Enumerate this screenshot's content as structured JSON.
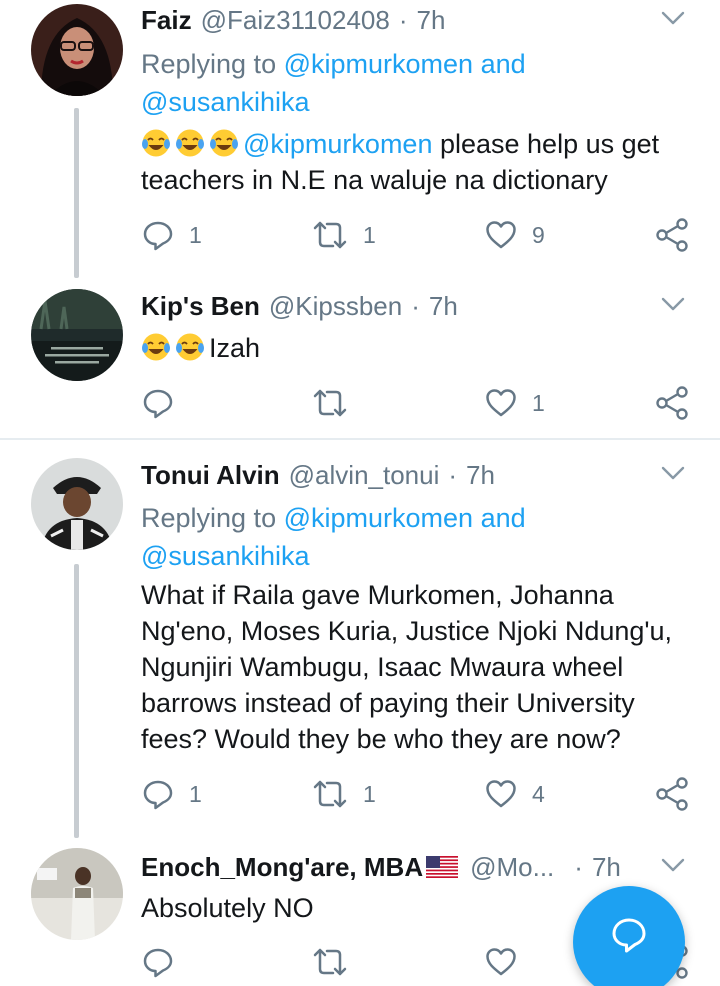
{
  "tweets": [
    {
      "display_name": "Faiz",
      "handle": "@Faiz31102408",
      "separator": "·",
      "time": "7h",
      "replying_prefix": "Replying to",
      "replying_users": [
        "@kipmurkomen",
        "and",
        "@susankihika"
      ],
      "body_mention": "@kipmurkomen",
      "body_text": " please help us get teachers in N.E na waluje na dictionary",
      "emoji_count": 3,
      "reply_count": "1",
      "retweet_count": "1",
      "like_count": "9"
    },
    {
      "display_name": "Kip's Ben",
      "handle": "@Kipssben",
      "separator": "·",
      "time": "7h",
      "body_text": "Izah",
      "emoji_count": 2,
      "reply_count": "",
      "retweet_count": "",
      "like_count": "1"
    },
    {
      "display_name": "Tonui Alvin",
      "handle": "@alvin_tonui",
      "separator": "·",
      "time": "7h",
      "replying_prefix": "Replying to",
      "replying_users": [
        "@kipmurkomen",
        "and",
        "@susankihika"
      ],
      "body_lines": [
        "What if Raila gave Murkomen, Johanna",
        "Ng'eno, Moses Kuria, Justice Njoki Ndung'u,",
        "Ngunjiri Wambugu, Isaac Mwaura wheel",
        "barrows instead of paying their University",
        "fees? Would they be who they are now?"
      ],
      "reply_count": "1",
      "retweet_count": "1",
      "like_count": "4"
    },
    {
      "display_name": "Enoch_Mong'are, MBA",
      "handle": "@Mo...",
      "separator": "·",
      "time": "7h",
      "body_text": "Absolutely NO",
      "reply_count": "",
      "retweet_count": "",
      "like_count": ""
    }
  ],
  "colors": {
    "accent": "#1da1f2",
    "secondary_text": "#657786",
    "divider": "#e6ecf0",
    "thread_line": "#c7ccd1"
  },
  "icons": [
    "chevron-down-icon",
    "reply-icon",
    "retweet-icon",
    "like-icon",
    "share-icon",
    "compose-reply-icon",
    "us-flag-icon",
    "tears-of-joy-emoji"
  ]
}
